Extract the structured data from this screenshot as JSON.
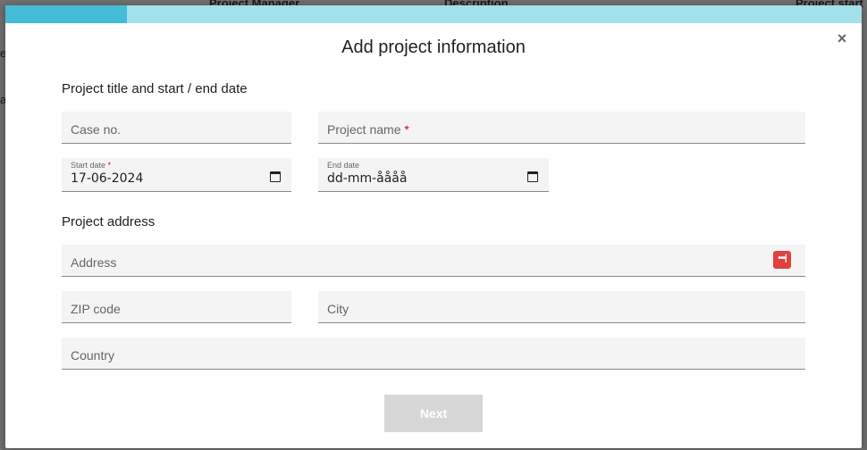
{
  "background": {
    "columns": [
      "Project Manager",
      "Description",
      "Project start"
    ],
    "row_chars": [
      "e",
      "a"
    ]
  },
  "progress": {
    "fraction": 0.142,
    "fill_color": "#44bcd6",
    "track_color": "#a2e0ea"
  },
  "modal": {
    "title": "Add project information",
    "close_symbol": "×"
  },
  "section1": {
    "title": "Project title and start / end date",
    "case_no_placeholder": "Case no.",
    "project_name_placeholder": "Project name",
    "start_date_label": "Start date",
    "start_date_value": "17-06-2024",
    "end_date_label": "End date",
    "end_date_value": "dd-mm-åååå",
    "required_mark": "*"
  },
  "section2": {
    "title": "Project address",
    "address_placeholder": "Address",
    "zip_placeholder": "ZIP code",
    "city_placeholder": "City",
    "country_placeholder": "Country",
    "password_manager_icon_text": "•••|"
  },
  "footer": {
    "next_label": "Next"
  }
}
